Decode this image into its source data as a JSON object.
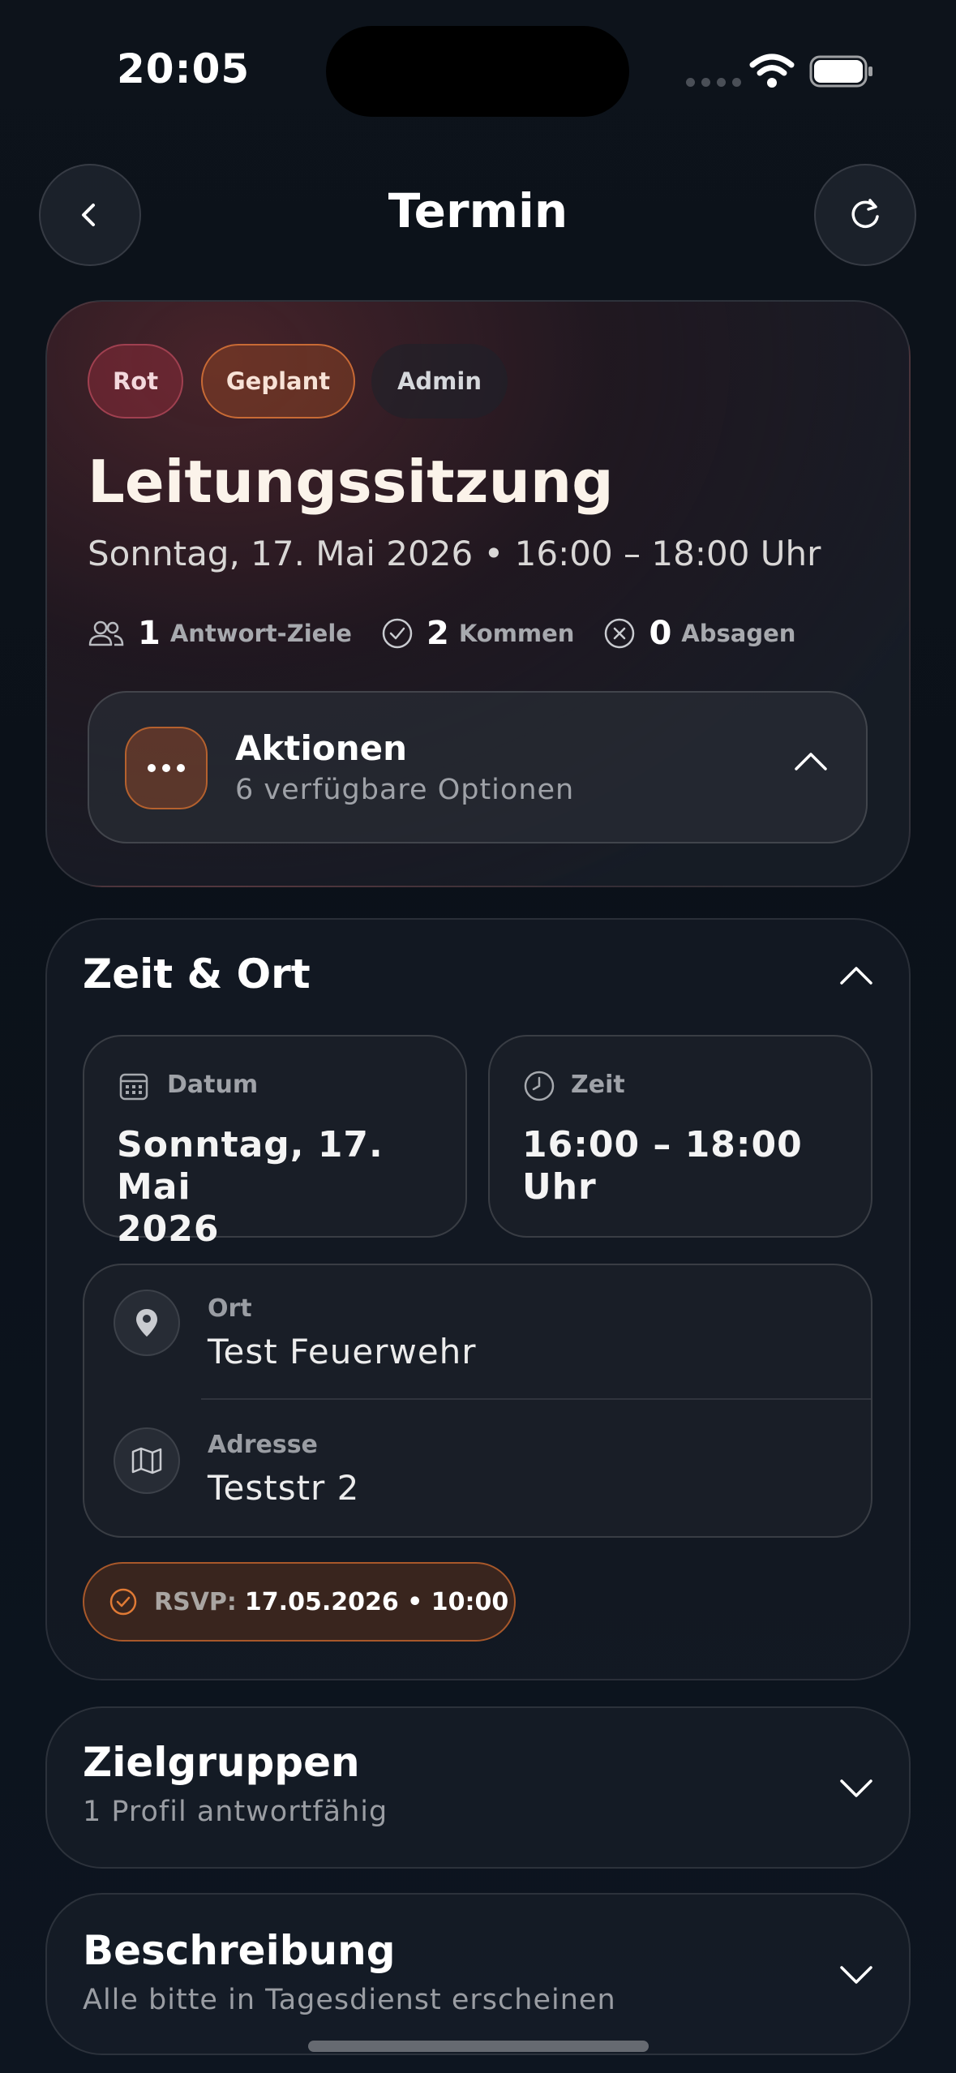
{
  "status_bar": {
    "time": "20:05"
  },
  "nav": {
    "title": "Termin",
    "back_icon": "chevron-left-icon",
    "refresh_icon": "refresh-icon"
  },
  "event": {
    "chips": {
      "color": "Rot",
      "status": "Geplant",
      "role": "Admin"
    },
    "title": "Leitungssitzung",
    "datetime": "Sonntag, 17. Mai 2026 • 16:00 – 18:00 Uhr",
    "stats": {
      "targets_count": "1",
      "targets_label": "Antwort-Ziele",
      "coming_count": "2",
      "coming_label": "Kommen",
      "declined_count": "0",
      "declined_label": "Absagen"
    },
    "actions": {
      "title": "Aktionen",
      "subtitle": "6 verfügbare Optionen"
    }
  },
  "time_place": {
    "title": "Zeit & Ort",
    "date_label": "Datum",
    "date_value_line1": "Sonntag, 17. Mai",
    "date_value_line2": "2026",
    "time_label": "Zeit",
    "time_value_line1": "16:00 – 18:00",
    "time_value_line2": "Uhr",
    "place_label": "Ort",
    "place_value": "Test Feuerwehr",
    "address_label": "Adresse",
    "address_value": "Teststr 2",
    "rsvp_label": "RSVP:",
    "rsvp_value": "17.05.2026 • 10:00"
  },
  "target_groups": {
    "title": "Zielgruppen",
    "subtitle": "1 Profil antwortfähig"
  },
  "description": {
    "title": "Beschreibung",
    "subtitle": "Alle bitte in Tagesdienst erscheinen"
  },
  "colors": {
    "accent_orange": "#c86a35",
    "accent_red": "#a04050",
    "background": "#0d131b"
  }
}
